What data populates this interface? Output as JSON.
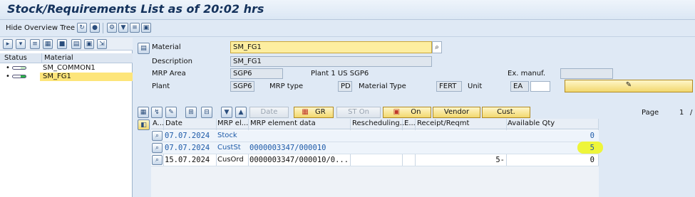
{
  "title": "Stock/Requirements List as of 20:02 hrs",
  "toolbar": {
    "hide_overview_tree": "Hide Overview Tree"
  },
  "left": {
    "col_status": "Status",
    "col_material": "Material",
    "rows": [
      {
        "material": "SM_COMMON1"
      },
      {
        "material": "SM_FG1"
      }
    ]
  },
  "header": {
    "material_label": "Material",
    "material_value": "SM_FG1",
    "description_label": "Description",
    "description_value": "SM_FG1",
    "mrp_area_label": "MRP Area",
    "mrp_area_value": "SGP6",
    "mrp_area_desc": "Plant 1 US SGP6",
    "ex_manuf_label": "Ex. manuf.",
    "ex_manuf_value": "",
    "plant_label": "Plant",
    "plant_value": "SGP6",
    "mrp_type_label": "MRP type",
    "mrp_type_value": "PD",
    "material_type_label": "Material Type",
    "material_type_value": "FERT",
    "unit_label": "Unit",
    "unit_value": "EA"
  },
  "actions": {
    "date": "Date",
    "gr": "GR",
    "st_on": "ST On",
    "on": "On",
    "vendor": "Vendor",
    "cust": "Cust.",
    "page_label": "Page",
    "page_value": "1",
    "page_sep": "/"
  },
  "grid": {
    "columns": [
      "A...",
      "Date",
      "MRP el...",
      "MRP element data",
      "Rescheduling...",
      "E...",
      "Receipt/Reqmt",
      "Available Qty"
    ],
    "rows": [
      {
        "date": "07.07.2024",
        "mrp_el": "Stock",
        "data": "",
        "resched": "",
        "e": "",
        "receipt": "",
        "avail": "0"
      },
      {
        "date": "07.07.2024",
        "mrp_el": "CustSt",
        "data": "0000003347/000010",
        "resched": "",
        "e": "",
        "receipt": "",
        "avail": "5"
      },
      {
        "date": "15.07.2024",
        "mrp_el": "CusOrd",
        "data": "0000003347/000010/0...",
        "resched": "",
        "e": "",
        "receipt": "5-",
        "avail": "0"
      }
    ]
  },
  "colors": {
    "highlight": "#fde57a",
    "marker": "#eef53a",
    "link": "#1d5aa8"
  }
}
